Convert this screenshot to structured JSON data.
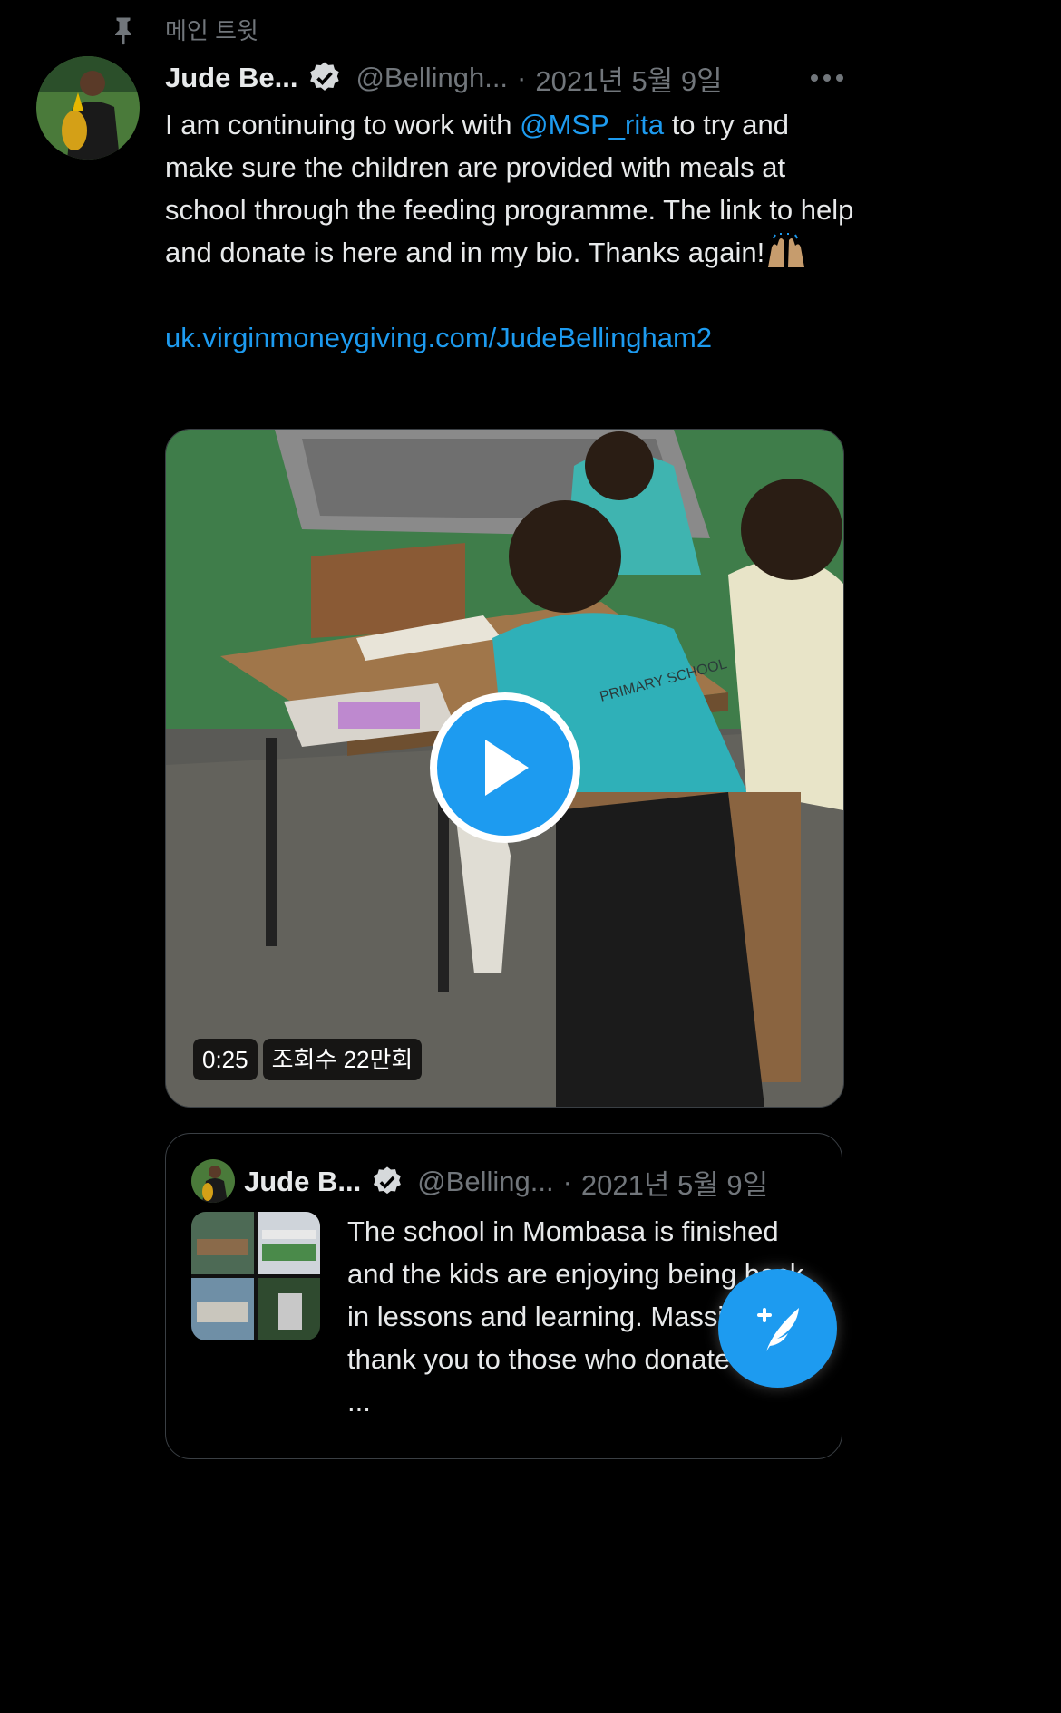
{
  "pinned": {
    "label": "메인 트윗",
    "icon": "pin-icon"
  },
  "tweet": {
    "author_name": "Jude Be...",
    "handle": "@Bellingh...",
    "separator": "·",
    "date": "2021년 5월 9일",
    "text_before_mention": "I am continuing to work with ",
    "mention": "@MSP_rita",
    "text_after_mention": " to try and make sure the children are provided with meals at school through the feeding programme. The link to help and donate is here and in my bio. Thanks again!",
    "url": "uk.virginmoneygiving.com/JudeBellingham2",
    "emoji": "raising-hands-icon"
  },
  "video": {
    "duration": "0:25",
    "views": "조회수 22만회",
    "shirt_text": "PRIMARY SCHOOL"
  },
  "quoted_tweet": {
    "author_name": "Jude B...",
    "handle": "@Belling...",
    "separator": "·",
    "date": "2021년 5월 9일",
    "text": "The school in Mombasa is finished and the kids are enjoying being back in lessons and learning. Massive thank you to those who donated and ..."
  },
  "colors": {
    "accent": "#1d9bf0",
    "background": "#000000",
    "text": "#e7e9ea",
    "muted": "#71767b"
  }
}
